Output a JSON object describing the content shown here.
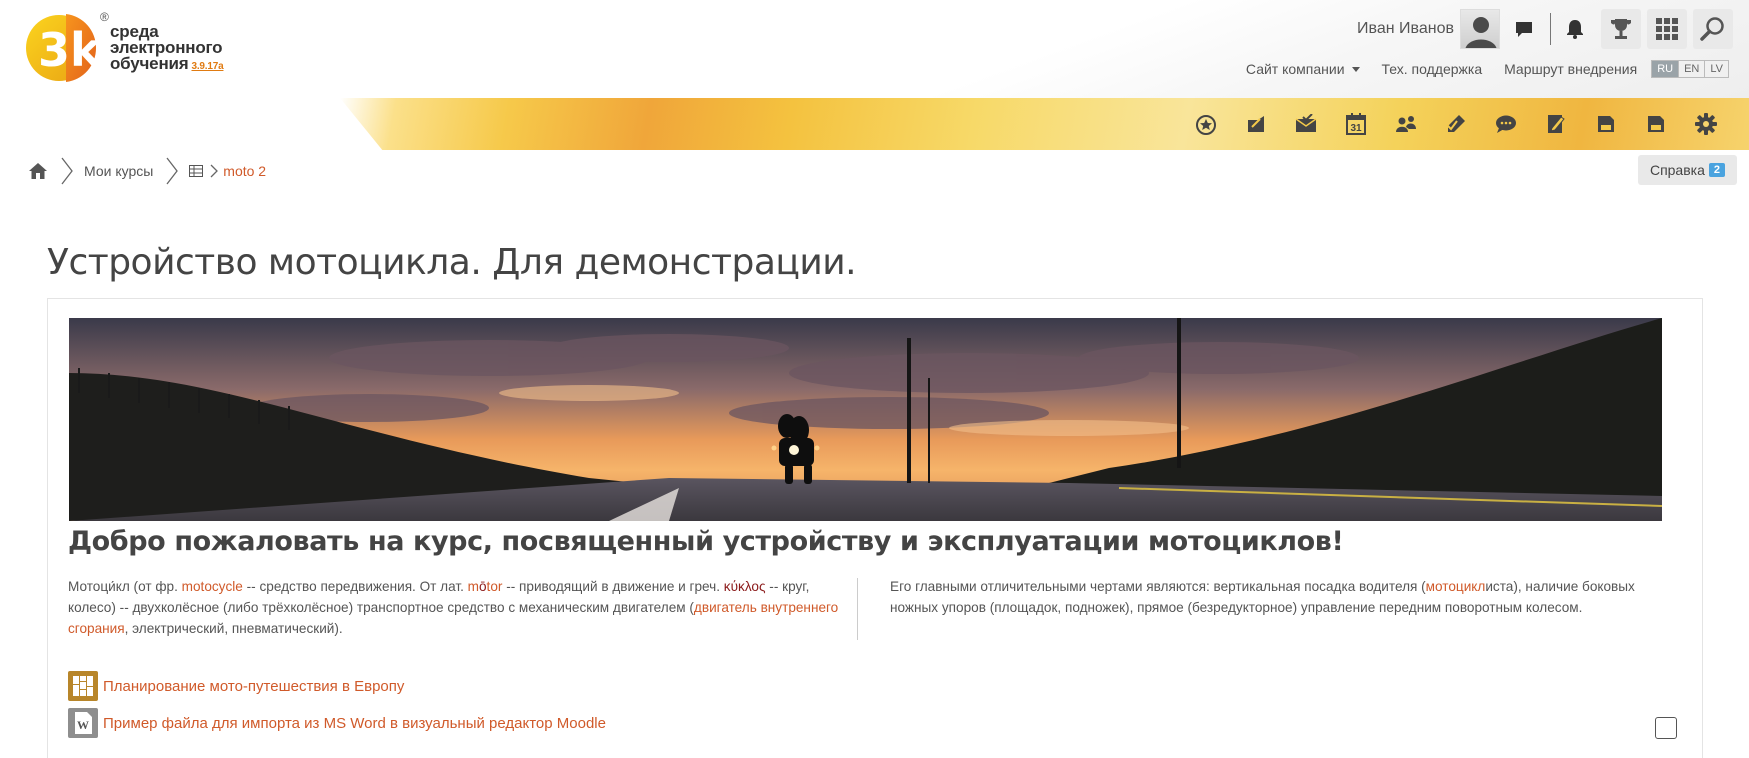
{
  "header": {
    "logo": {
      "mark_text": "3k",
      "reg_symbol": "®",
      "line1": "среда",
      "line2": "электронного",
      "line3": "обучения",
      "version": "3.9.17a"
    },
    "user": {
      "name": "Иван Иванов"
    },
    "icons": [
      "chat-icon",
      "bell-icon",
      "trophy-icon",
      "apps-grid-icon",
      "search-icon"
    ],
    "nav": {
      "company_site": "Сайт компании",
      "support": "Тех. поддержка",
      "rollout": "Маршрут внедрения"
    },
    "languages": [
      "RU",
      "EN",
      "LV"
    ],
    "toolbar_icons": [
      "star-badge-icon",
      "send-icon",
      "mail-check-icon",
      "calendar-icon",
      "users-icon",
      "pencil-check-icon",
      "comments-icon",
      "edit-note-icon",
      "report-icon",
      "report-alt-icon",
      "gear-icon"
    ],
    "calendar_day": "31"
  },
  "breadcrumb": {
    "my_courses": "Мои курсы",
    "current": "moto 2"
  },
  "help": {
    "label": "Справка",
    "count": "2"
  },
  "course": {
    "title": "Устройство мотоцикла. Для демонстрации.",
    "welcome": "Добро пожаловать на курс, посвященный устройству и эксплуатации мотоциклов!",
    "left": {
      "t1": "Мотоци́кл (от фр. ",
      "l1": "motocycle",
      "t2": " -- средство передвижения. От лат. ",
      "l2a": "m",
      "l2b": "ō",
      "l2c": "tor",
      "t3": " -- приводящий в движение и греч. ",
      "l3": "κύκλος",
      "t4": " -- круг, колесо) -- двухколёсное (либо трёхколёсное) транспортное средство с механическим двигателем (",
      "l4": "двигатель внутреннего сгорания",
      "t5": ", электрический, пневматический)."
    },
    "right": {
      "t1": "Его главными отличительными чертами являются: вертикальная посадка водителя (",
      "l1": "мотоцикл",
      "t2": "иста), наличие боковых ножных упоров (площадок, подножек), прямое (безредукторное) управление передним поворотным колесом."
    },
    "activities": [
      {
        "label": "Планирование мото-путешествия в Европу",
        "icon": "board-icon"
      },
      {
        "label": "Пример файла для импорта из MS Word в визуальный редактор Moodle",
        "icon": "word-file-icon",
        "icon_text": "W"
      }
    ]
  },
  "colors": {
    "accent": "#d05a2a",
    "logo_orange": "#f29a1e",
    "logo_yellow": "#f7c31a",
    "badge_blue": "#4aa3df"
  }
}
